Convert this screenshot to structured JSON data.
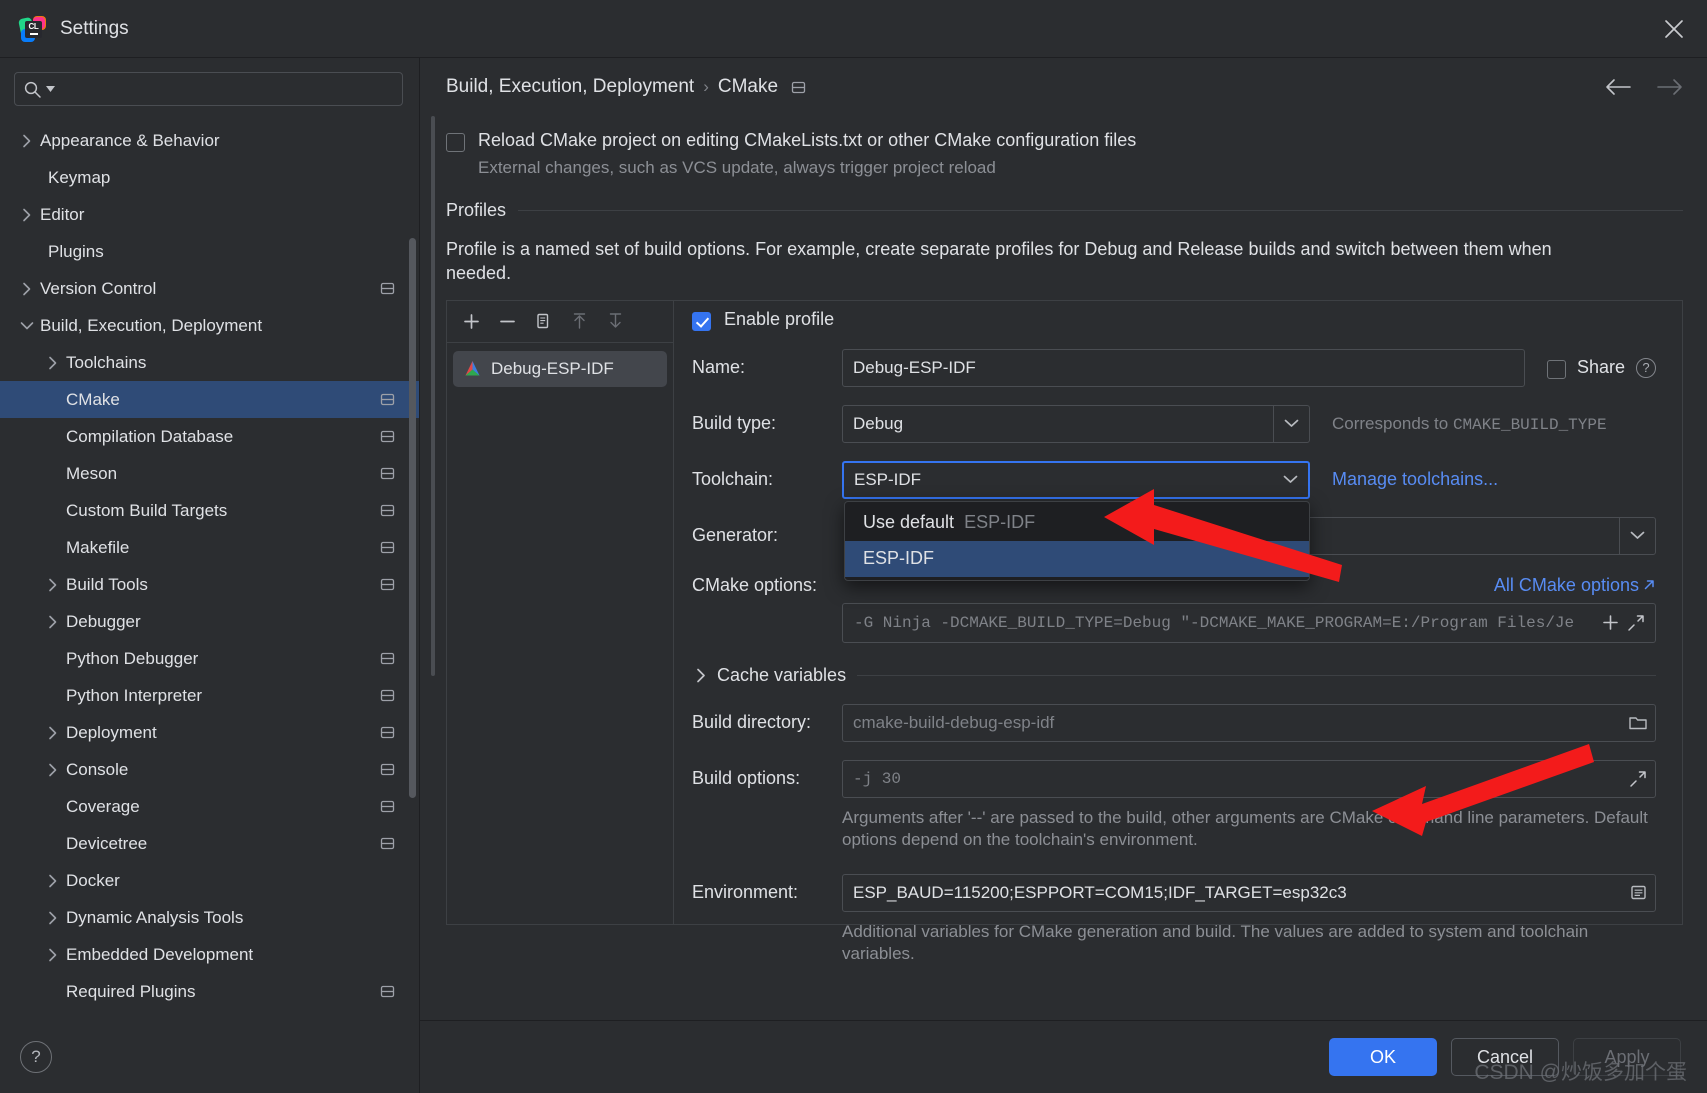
{
  "window": {
    "title": "Settings",
    "app_icon": "clion-logo-icon",
    "close_icon": "close-icon"
  },
  "search": {
    "placeholder": "",
    "value": "",
    "icon": "search-icon"
  },
  "sidebar": {
    "items": [
      {
        "label": "Appearance & Behavior",
        "level": 0,
        "arrow": "chevron-right",
        "badge": false
      },
      {
        "label": "Keymap",
        "level": 0,
        "arrow": "none",
        "badge": false
      },
      {
        "label": "Editor",
        "level": 0,
        "arrow": "chevron-right",
        "badge": false
      },
      {
        "label": "Plugins",
        "level": 0,
        "arrow": "none",
        "badge": false
      },
      {
        "label": "Version Control",
        "level": 0,
        "arrow": "chevron-right",
        "badge": true
      },
      {
        "label": "Build, Execution, Deployment",
        "level": 0,
        "arrow": "chevron-down",
        "badge": false
      },
      {
        "label": "Toolchains",
        "level": 1,
        "arrow": "chevron-right",
        "badge": false
      },
      {
        "label": "CMake",
        "level": 1,
        "arrow": "none",
        "badge": true,
        "selected": true
      },
      {
        "label": "Compilation Database",
        "level": 1,
        "arrow": "none",
        "badge": true
      },
      {
        "label": "Meson",
        "level": 1,
        "arrow": "none",
        "badge": true
      },
      {
        "label": "Custom Build Targets",
        "level": 1,
        "arrow": "none",
        "badge": true
      },
      {
        "label": "Makefile",
        "level": 1,
        "arrow": "none",
        "badge": true
      },
      {
        "label": "Build Tools",
        "level": 1,
        "arrow": "chevron-right",
        "badge": true
      },
      {
        "label": "Debugger",
        "level": 1,
        "arrow": "chevron-right",
        "badge": false
      },
      {
        "label": "Python Debugger",
        "level": 1,
        "arrow": "none",
        "badge": true
      },
      {
        "label": "Python Interpreter",
        "level": 1,
        "arrow": "none",
        "badge": true
      },
      {
        "label": "Deployment",
        "level": 1,
        "arrow": "chevron-right",
        "badge": true
      },
      {
        "label": "Console",
        "level": 1,
        "arrow": "chevron-right",
        "badge": true
      },
      {
        "label": "Coverage",
        "level": 1,
        "arrow": "none",
        "badge": true
      },
      {
        "label": "Devicetree",
        "level": 1,
        "arrow": "none",
        "badge": true
      },
      {
        "label": "Docker",
        "level": 1,
        "arrow": "chevron-right",
        "badge": false
      },
      {
        "label": "Dynamic Analysis Tools",
        "level": 1,
        "arrow": "chevron-right",
        "badge": false
      },
      {
        "label": "Embedded Development",
        "level": 1,
        "arrow": "chevron-right",
        "badge": false
      },
      {
        "label": "Required Plugins",
        "level": 1,
        "arrow": "none",
        "badge": true
      }
    ],
    "help_button": "?"
  },
  "breadcrumb": {
    "parent": "Build, Execution, Deployment",
    "separator": "›",
    "current": "CMake",
    "badge_icon": "project-scope-icon",
    "back_icon": "arrow-left-icon",
    "forward_icon": "arrow-right-icon"
  },
  "main": {
    "reload_checkbox": {
      "label": "Reload CMake project on editing CMakeLists.txt or other CMake configuration files",
      "checked": false
    },
    "reload_note": "External changes, such as VCS update, always trigger project reload",
    "profiles_group_title": "Profiles",
    "profiles_description": "Profile is a named set of build options. For example, create separate profiles for Debug and Release builds and switch between them when needed."
  },
  "profile_list": {
    "toolbar": [
      {
        "name": "add-profile-button",
        "glyph": "plus",
        "enabled": true
      },
      {
        "name": "remove-profile-button",
        "glyph": "minus",
        "enabled": true
      },
      {
        "name": "copy-profile-button",
        "glyph": "copy",
        "enabled": true
      },
      {
        "name": "move-up-button",
        "glyph": "arrow-up",
        "enabled": false
      },
      {
        "name": "move-down-button",
        "glyph": "arrow-down",
        "enabled": false
      }
    ],
    "items": [
      {
        "label": "Debug-ESP-IDF",
        "selected": true,
        "icon": "cmake-profile-icon"
      }
    ]
  },
  "form": {
    "enable_profile": {
      "label": "Enable profile",
      "checked": true
    },
    "name": {
      "label": "Name:",
      "value": "Debug-ESP-IDF"
    },
    "share": {
      "label": "Share",
      "checked": false,
      "help_glyph": "?"
    },
    "build_type": {
      "label": "Build type:",
      "value": "Debug"
    },
    "build_type_hint_prefix": "Corresponds to ",
    "build_type_hint_mono": "CMAKE_BUILD_TYPE",
    "toolchain": {
      "label": "Toolchain:",
      "value": "ESP-IDF",
      "focused": true
    },
    "manage_toolchains_link": "Manage toolchains...",
    "toolchain_dropdown": {
      "open": true,
      "options": [
        {
          "label": "Use default",
          "suffix": "ESP-IDF",
          "selected": false
        },
        {
          "label": "ESP-IDF",
          "suffix": "",
          "selected": true
        }
      ]
    },
    "generator": {
      "label": "Generator:",
      "value": ""
    },
    "cmake_options": {
      "label": "CMake options:",
      "value": "-G Ninja -DCMAKE_BUILD_TYPE=Debug \"-DCMAKE_MAKE_PROGRAM=E:/Program Files/Je",
      "add_glyph": "+",
      "expand_glyph": "expand-icon"
    },
    "all_cmake_options_link": "All CMake options",
    "cache_variables": {
      "label": "Cache variables",
      "expanded": false
    },
    "build_directory": {
      "label": "Build directory:",
      "value": "cmake-build-debug-esp-idf",
      "browse_icon": "folder-icon"
    },
    "build_options": {
      "label": "Build options:",
      "value": "-j 30",
      "expand_icon": "expand-icon"
    },
    "build_options_note": "Arguments after '--' are passed to the build, other arguments are CMake command line parameters. Default options depend on the toolchain's environment.",
    "environment": {
      "label": "Environment:",
      "value": "ESP_BAUD=115200;ESPPORT=COM15;IDF_TARGET=esp32c3",
      "edit_icon": "list-edit-icon"
    },
    "environment_note": "Additional variables for CMake generation and build. The values are added to system and toolchain variables."
  },
  "footer": {
    "ok": "OK",
    "cancel": "Cancel",
    "apply": "Apply"
  },
  "watermark": "CSDN @炒饭多加个蛋",
  "colors": {
    "accent": "#3574f0",
    "selection": "#2f4b77",
    "link": "#588cf3",
    "panel": "#2b2d30",
    "popup": "#1e1f22",
    "annotation_arrow": "#f31b1b"
  }
}
